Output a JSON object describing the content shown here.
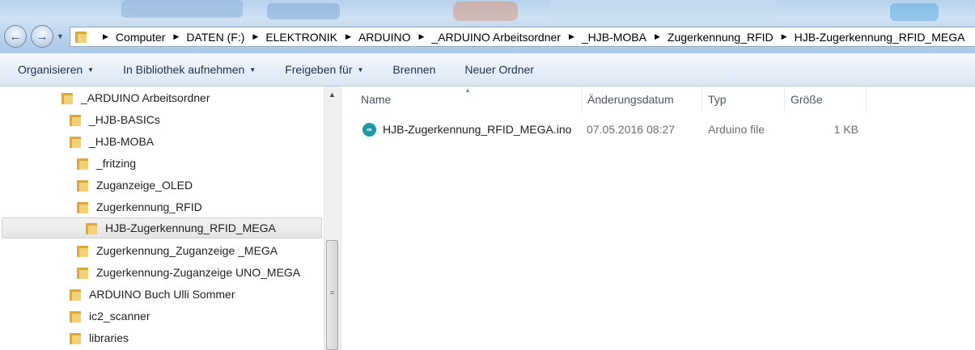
{
  "navigation": {
    "back_glyph": "←",
    "forward_glyph": "→",
    "breadcrumb": [
      "Computer",
      "DATEN (F:)",
      "ELEKTRONIK",
      "ARDUINO",
      "_ARDUINO Arbeitsordner",
      "_HJB-MOBA",
      "Zugerkennung_RFID",
      "HJB-Zugerkennung_RFID_MEGA"
    ]
  },
  "toolbar": {
    "organize": "Organisieren",
    "include_library": "In Bibliothek aufnehmen",
    "share": "Freigeben für",
    "burn": "Brennen",
    "new_folder": "Neuer Ordner"
  },
  "tree": {
    "items": [
      {
        "label": "_ARDUINO Arbeitsordner"
      },
      {
        "label": "_HJB-BASICs"
      },
      {
        "label": "_HJB-MOBA"
      },
      {
        "label": "_fritzing"
      },
      {
        "label": "Zuganzeige_OLED"
      },
      {
        "label": "Zugerkennung_RFID"
      },
      {
        "label": "HJB-Zugerkennung_RFID_MEGA"
      },
      {
        "label": "Zugerkennung_Zuganzeige _MEGA"
      },
      {
        "label": "Zugerkennung-Zuganzeige UNO_MEGA"
      },
      {
        "label": "ARDUINO Buch Ulli Sommer"
      },
      {
        "label": "ic2_scanner"
      },
      {
        "label": "libraries"
      }
    ]
  },
  "columns": {
    "name": "Name",
    "date": "Änderungsdatum",
    "type": "Typ",
    "size": "Größe"
  },
  "files": [
    {
      "name": "HJB-Zugerkennung_RFID_MEGA.ino",
      "date": "07.05.2016 08:27",
      "type": "Arduino file",
      "size": "1 KB"
    }
  ],
  "icons": {
    "folder_color": "#d9a93b",
    "arduino_color": "#1e9aa5"
  }
}
